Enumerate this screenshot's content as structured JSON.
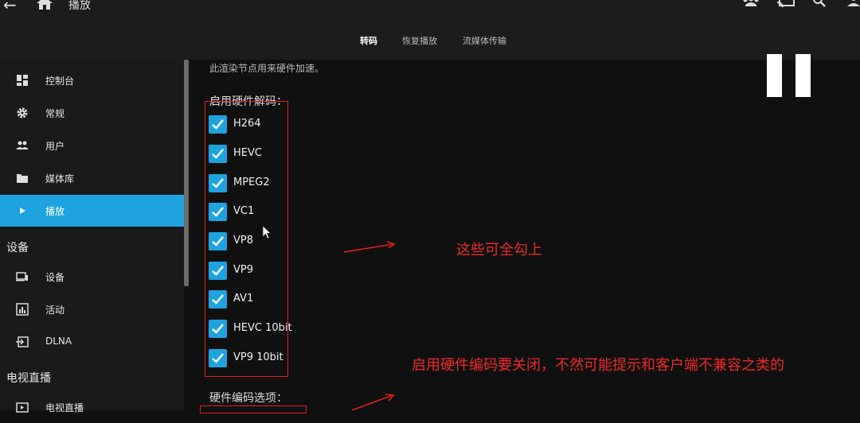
{
  "header": {
    "back_icon": "back-arrow-icon",
    "home_icon": "home-icon",
    "title": "播放",
    "right_icons": [
      "users-icon",
      "cast-icon",
      "search-icon",
      "account-icon"
    ]
  },
  "tabs": [
    {
      "label": "转码",
      "active": true
    },
    {
      "label": "恢复播放",
      "active": false
    },
    {
      "label": "流媒体传输",
      "active": false
    }
  ],
  "sidebar": {
    "items": [
      {
        "label": "控制台",
        "icon": "dashboard-icon"
      },
      {
        "label": "常规",
        "icon": "gear-icon"
      },
      {
        "label": "用户",
        "icon": "users-icon"
      },
      {
        "label": "媒体库",
        "icon": "folder-icon"
      },
      {
        "label": "播放",
        "icon": "play-icon",
        "active": true
      }
    ],
    "section_devices": "设备",
    "device_items": [
      {
        "label": "设备",
        "icon": "devices-icon"
      },
      {
        "label": "活动",
        "icon": "activity-icon"
      },
      {
        "label": "DLNA",
        "icon": "dlna-icon"
      }
    ],
    "section_livetv": "电视直播",
    "livetv_items": [
      {
        "label": "电视直播",
        "icon": "tv-icon"
      }
    ]
  },
  "content": {
    "description": "此渲染节点用来硬件加速。",
    "decode_label": "启用硬件解码：",
    "codecs": [
      "H264",
      "HEVC",
      "MPEG2",
      "VC1",
      "VP8",
      "VP9",
      "AV1",
      "HEVC 10bit",
      "VP9 10bit"
    ],
    "encode_label": "硬件编码选项："
  },
  "annotations": {
    "note_1": "这些可全勾上",
    "note_2": "启用硬件编码要关闭，不然可能提示和客户端不兼容之类的",
    "color": "#e02020"
  },
  "overlay": {
    "pause_icon": "pause-icon"
  },
  "colors": {
    "accent": "#1fa3df",
    "annotation": "#e02020"
  }
}
